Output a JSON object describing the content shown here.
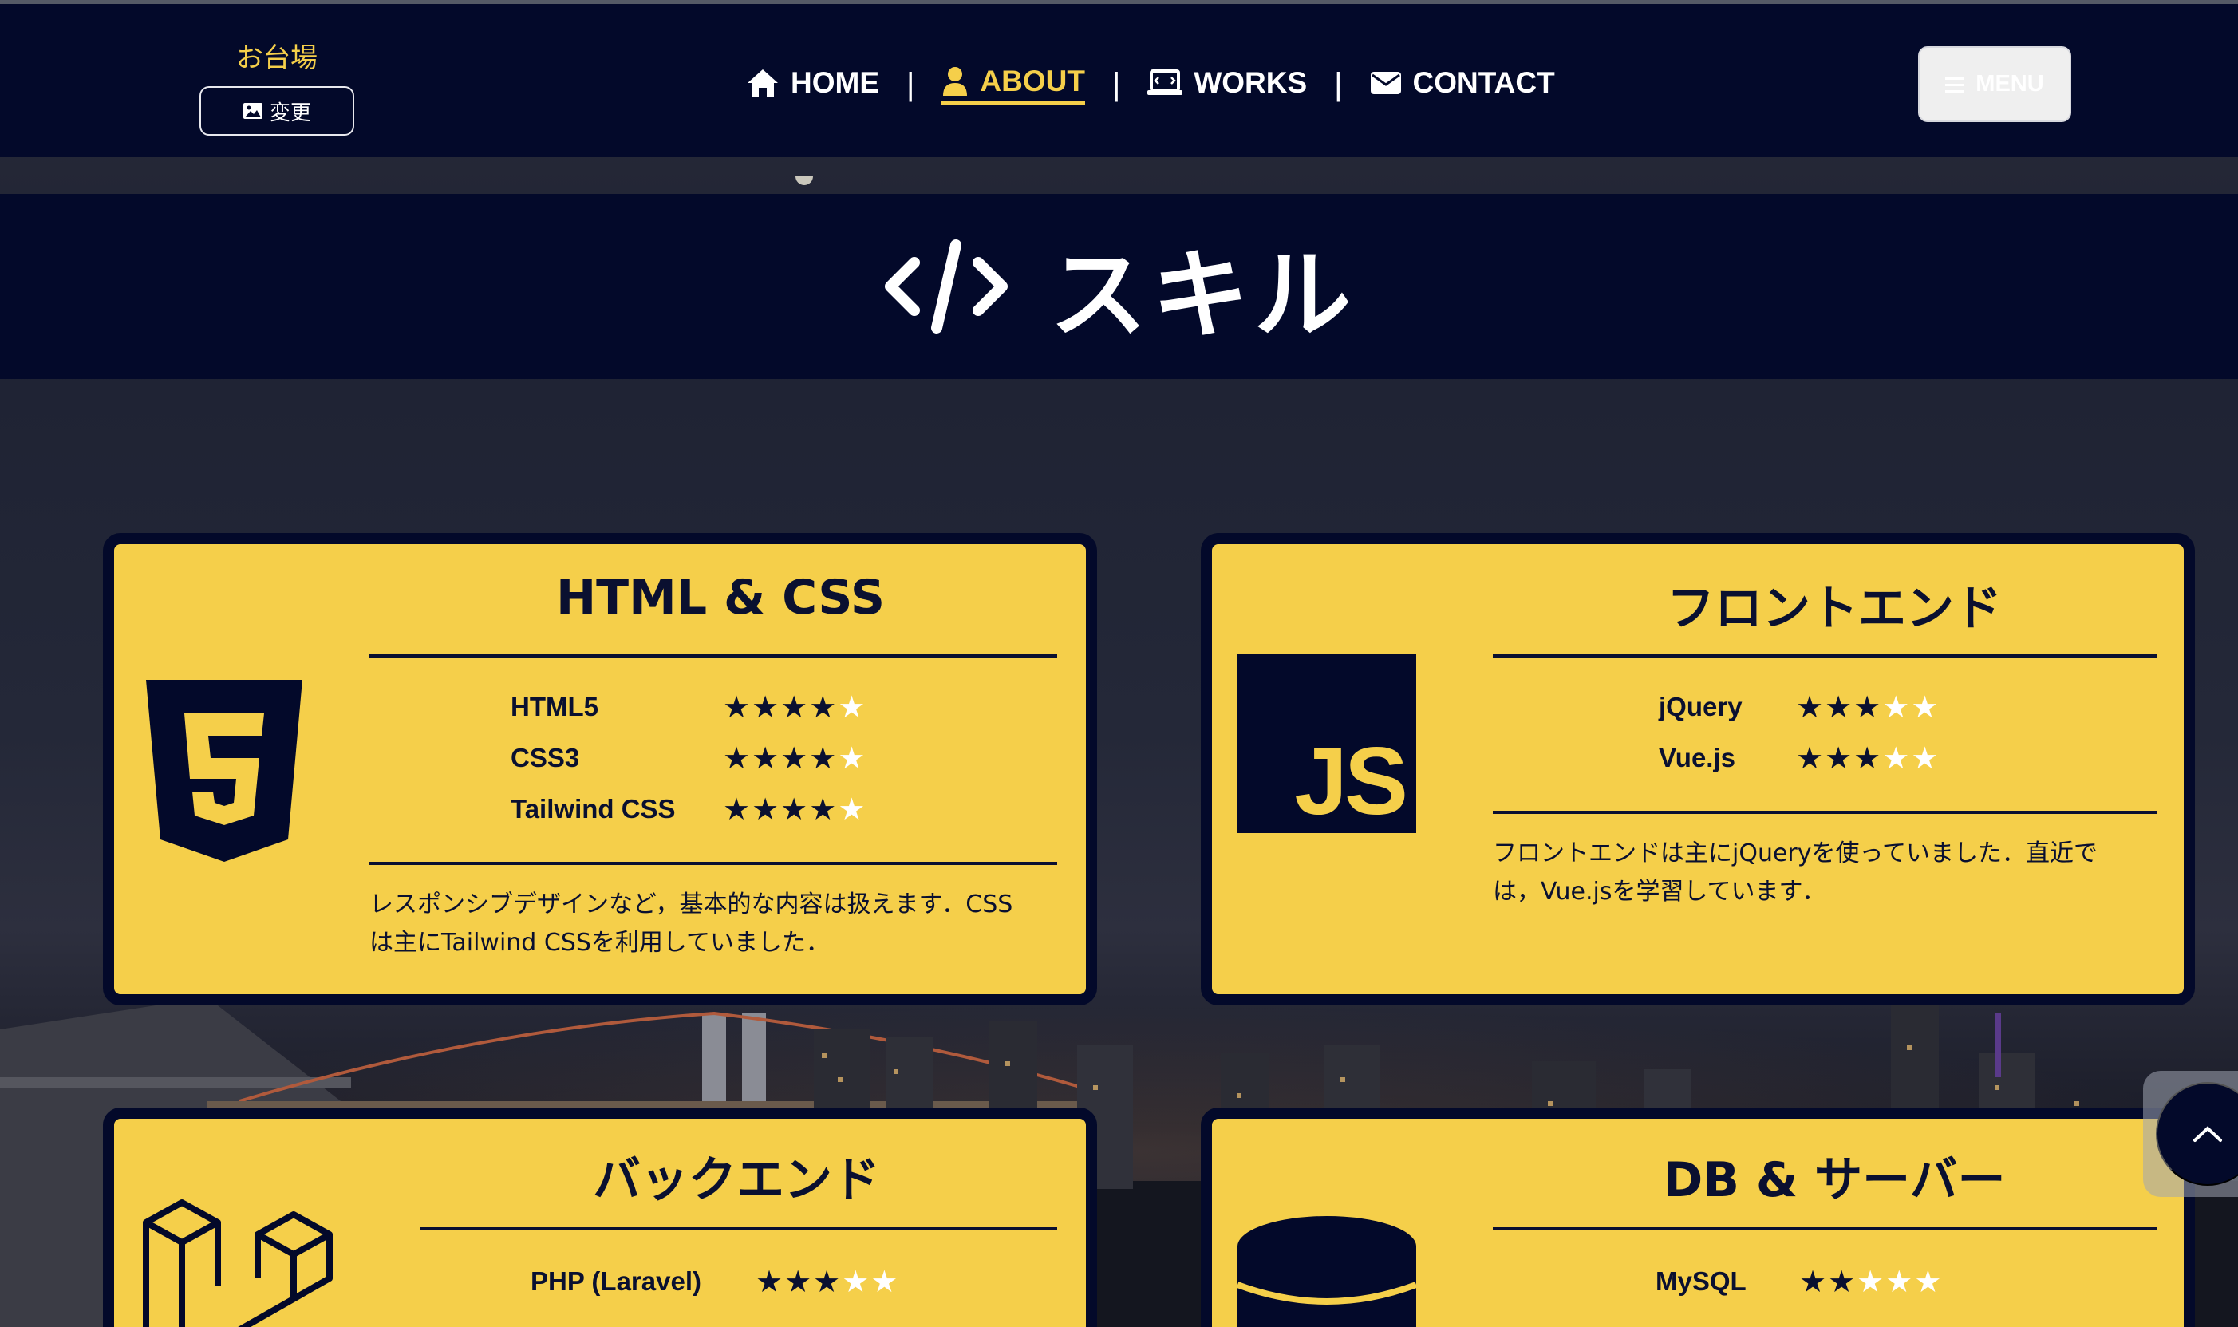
{
  "header": {
    "location_label": "お台場",
    "change_button": "変更",
    "nav": [
      {
        "label": "HOME",
        "icon": "home-icon",
        "active": false
      },
      {
        "label": "ABOUT",
        "icon": "user-icon",
        "active": true
      },
      {
        "label": "WORKS",
        "icon": "laptop-icon",
        "active": false
      },
      {
        "label": "CONTACT",
        "icon": "envelope-icon",
        "active": false
      }
    ],
    "separator": "|",
    "menu_button": "MENU"
  },
  "section": {
    "title": "スキル",
    "icon": "code-icon"
  },
  "cards": [
    {
      "heading": "HTML & CSS",
      "icon": "html5-icon",
      "skills": [
        {
          "name": "HTML5",
          "rating": 4,
          "max": 5
        },
        {
          "name": "CSS3",
          "rating": 4,
          "max": 5
        },
        {
          "name": "Tailwind CSS",
          "rating": 4,
          "max": 5
        }
      ],
      "description_line1": "レスポンシブデザインなど，基本的な内容は扱えます．CSS",
      "description_line2": "は主にTailwind CSSを利用していました．"
    },
    {
      "heading": "フロントエンド",
      "icon": "javascript-icon",
      "icon_text": "JS",
      "skills": [
        {
          "name": "jQuery",
          "rating": 3,
          "max": 5
        },
        {
          "name": "Vue.js",
          "rating": 3,
          "max": 5
        }
      ],
      "description_line1": "フロントエンドは主にjQueryを使っていました．直近で",
      "description_line2": "は，Vue.jsを学習しています．"
    },
    {
      "heading": "バックエンド",
      "icon": "laravel-icon",
      "skills": [
        {
          "name": "PHP (Laravel)",
          "rating": 3,
          "max": 5
        }
      ]
    },
    {
      "heading": "DB & サーバー",
      "icon": "database-icon",
      "skills": [
        {
          "name": "MySQL",
          "rating": 2,
          "max": 5
        }
      ]
    }
  ],
  "colors": {
    "navy": "#03092a",
    "accent": "#f5cf4a",
    "text_dark": "#0a1030",
    "white": "#ffffff"
  },
  "scroll_top_icon": "chevron-up-icon"
}
